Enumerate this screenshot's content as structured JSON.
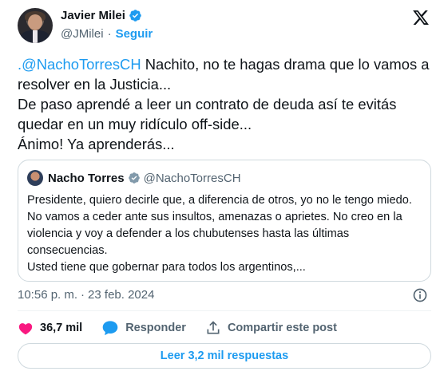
{
  "author": {
    "name": "Javier Milei",
    "handle": "@JMilei",
    "separator": "·",
    "follow_label": "Seguir"
  },
  "tweet": {
    "mention": ".@NachoTorresCH",
    "text": " Nachito, no te hagas drama que lo vamos a resolver en la Justicia...\nDe paso aprendé a leer un contrato de deuda así te evitás quedar en un muy ridículo off-side...\nÁnimo! Ya aprenderás..."
  },
  "quote": {
    "name": "Nacho Torres",
    "handle": "@NachoTorresCH",
    "text": "Presidente, quiero decirle que, a diferencia de otros, yo no le tengo miedo. No vamos a ceder ante sus insultos, amenazas o aprietes. No creo en la violencia y voy a defender a los chubutenses hasta las últimas consecuencias.\nUsted tiene que gobernar para todos los argentinos,..."
  },
  "meta": {
    "time": "10:56 p. m.",
    "separator": "·",
    "date": "23 feb. 2024"
  },
  "actions": {
    "likes": "36,7 mil",
    "reply_label": "Responder",
    "share_label": "Compartir este post"
  },
  "replies_button": "Leer 3,2 mil respuestas",
  "colors": {
    "accent": "#1d9bf0",
    "like": "#f91880",
    "muted": "#536471",
    "text": "#0f1419",
    "border": "#cfd9de"
  },
  "icons": [
    "verified-badge-icon",
    "x-logo-icon",
    "info-icon",
    "heart-icon",
    "reply-bubble-icon",
    "share-icon"
  ]
}
